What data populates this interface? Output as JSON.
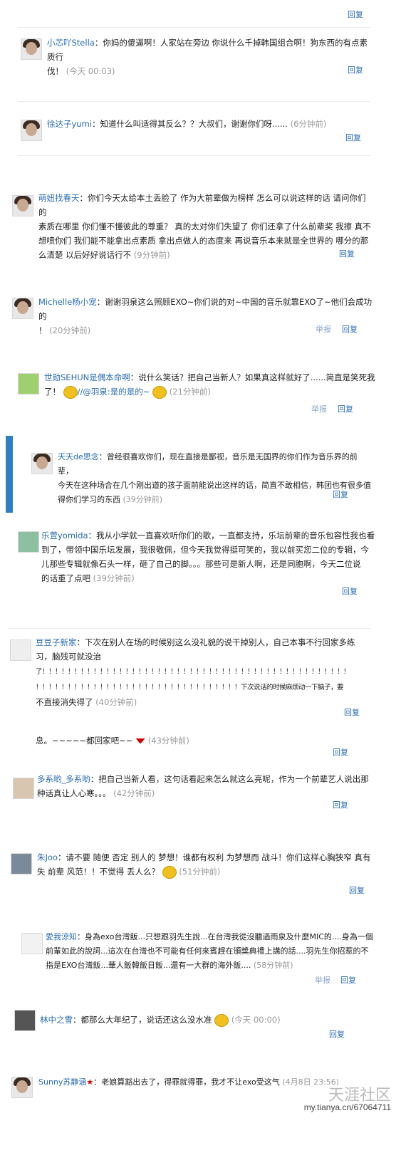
{
  "reply_label": "回复",
  "report_label": "举报",
  "comments": [
    {
      "user": "小芯吖Stella",
      "text": "：你妈的傻逼啊！人家站在旁边 你说什么千掉韩国组合啊！狗东西的有点素质行",
      "text2": "伐！",
      "time": "(今天 00:03)"
    },
    {
      "user": "徐达子yumi",
      "text": "：知道什么叫适得其反么？？大叔们，谢谢你们呀......",
      "time": "(6分钟前)"
    },
    {
      "user": "萌妞找春天",
      "text": "：你们今天太给本土丢脸了 作为大前辈做为榜样 怎么可以说这样的话 请问你们的",
      "text2": "素质在哪里 你们懂不懂彼此的尊重？ 真的太对你们失望了 你们还拿了什么前辈奖 我擦 真不",
      "text3": "想喷你们 我们能不能拿出点素质 拿出点做人的态度来 再说音乐本来就是全世界的 哪分的那",
      "text4": "么清楚 以后好好说话行不",
      "time": "(9分钟前)"
    },
    {
      "user": "Michelle杨小宠",
      "text": "：谢谢羽泉这么照顾EXO~你们说的对~中国的音乐就靠EXO了~他们会成功的",
      "text2": "！",
      "time": "(20分钟前)"
    },
    {
      "user": "世勋SEHUN是偶本命啊",
      "text": "：说什么笑话？把自己当新人？如果真这样就好了......简直是笑死我",
      "text2": "了！",
      "text2b": "//@羽泉:是的是的~",
      "time": "(21分钟前)"
    },
    {
      "user": "天天de思念",
      "text": "：曾经很喜欢你们，现在直接是鄙视，音乐是无国界的你们作为音乐界的前辈，",
      "text2": "今天在这种场合在几个刚出道的孩子面前能说出这样的话，简直不敢相信，韩团也有很多值",
      "text3": "得你们学习的东西",
      "time": "(39分钟前)"
    },
    {
      "user": "乐萱yomida",
      "text": "：我从小学就一直喜欢听你们的歌，一直都支持，乐坛前辈的音乐包容性我也看",
      "text2": "到了，带领中国乐坛发展，我很敬佩，但今天我觉得挺可笑的，我以前买您二位的专辑，今",
      "text3": "儿那些专辑就像石头一样，砸了自己的脚。。。那些可是新人啊，还是同胞啊，今天二位说",
      "text4": "的话重了点吧",
      "time": "(39分钟前)"
    },
    {
      "user": "豆豆子新家",
      "text": "：下次在别人在场的时候别这么没礼貌的说干掉别人，自己本事不行回家多练",
      "text2": "习，脑残可就没治",
      "text3": "了！！！！！！！！！！！！！！！！！！！！！！！！！！！！！！！！！！！！！！！！！！！！！！！！",
      "text4": "！！！！！！！！！！！！！！！！！！！！！！！！！！！！！！！！下次说话的时候麻烦动一下脑子，要",
      "text5": "不直接消失得了",
      "time": "(40分钟前)"
    },
    {
      "user": "",
      "text": "息。~~~~~都回家吧~~",
      "time": "(43分钟前)"
    },
    {
      "user": "多系哟_多系哟",
      "text": "：把自己当新人看，这句话看起来怎么就这么亮呢，作为一个前辈艺人说出那",
      "text2": "种话真让人心寒。。。",
      "time": "(42分钟前)"
    },
    {
      "user": "朱Joo",
      "text": "：请不要 随便 否定 别人的 梦想！谁都有权利 为梦想而 战斗！你们这样心胸狭窄 真有",
      "text2": "失 前辈 风范！！不觉得 丢人么？",
      "time": "(51分钟前)"
    },
    {
      "user": "愛我涼知",
      "text": "：身為exo台灣飯...只想跟羽先生說...在台灣我從沒聽過雨泉及什麼MIC的....身為一個",
      "text2": "前輩如此的說詞...這次在台灣也不可能有任何來賓趕在頒獎典禮上講的話....羽先生你招惹的不",
      "text3": "指是EXO台灣飯...華人飯韓飯日飯...還有一大群的海外飯....",
      "time": "(58分钟前)"
    },
    {
      "user": "林中之雪",
      "text": "：都那么大年纪了，说话还这么没水准",
      "time": "(今天 00:00)"
    },
    {
      "user": "Sunny苏静涵",
      "text": "：老娘算豁出去了，得罪就得罪，我才不让exo受这气",
      "time": "(4月8日 23:56)"
    }
  ],
  "watermark": {
    "logo": "天涯社区",
    "url": "my.tianya.cn/67064711"
  }
}
